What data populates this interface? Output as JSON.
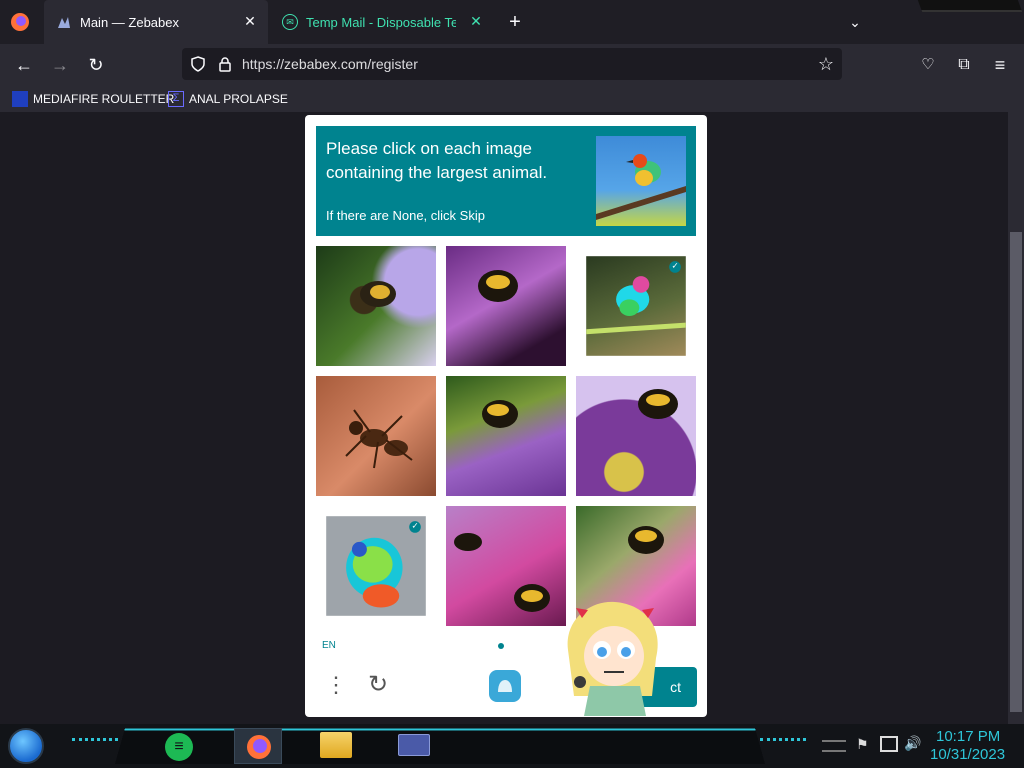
{
  "browser": {
    "tabs": [
      {
        "title": "Main — Zebabex",
        "active": true
      },
      {
        "title": "Temp Mail - Disposable Tempo",
        "active": false
      }
    ],
    "url_prefix": "https://",
    "url_domain": "zebabex.com",
    "url_path": "/register",
    "bookmarks": [
      {
        "label": "MEDIAFIRE ROULETTER"
      },
      {
        "label": "ANAL PROLAPSE"
      }
    ]
  },
  "captcha": {
    "prompt": "Please click on each image containing the largest animal.",
    "prompt_sub": "If there are None, click Skip",
    "language": "EN",
    "submit_label": "ct",
    "check_mark": "✓",
    "images": [
      {
        "subject": "bee on lavender flower",
        "selected": false
      },
      {
        "subject": "bee on purple flower",
        "selected": false
      },
      {
        "subject": "colorful bird on branch",
        "selected": true
      },
      {
        "subject": "ant on wood",
        "selected": false
      },
      {
        "subject": "bee on purple flower",
        "selected": false
      },
      {
        "subject": "bee on purple daisy",
        "selected": false
      },
      {
        "subject": "abstract colorful bird",
        "selected": true
      },
      {
        "subject": "bees on pink flower",
        "selected": false
      },
      {
        "subject": "bee on pink flower",
        "selected": false
      }
    ]
  },
  "taskbar": {
    "time": "10:17 PM",
    "date": "10/31/2023"
  },
  "colors": {
    "accent": "#00838f",
    "clock": "#2ec6d8"
  }
}
